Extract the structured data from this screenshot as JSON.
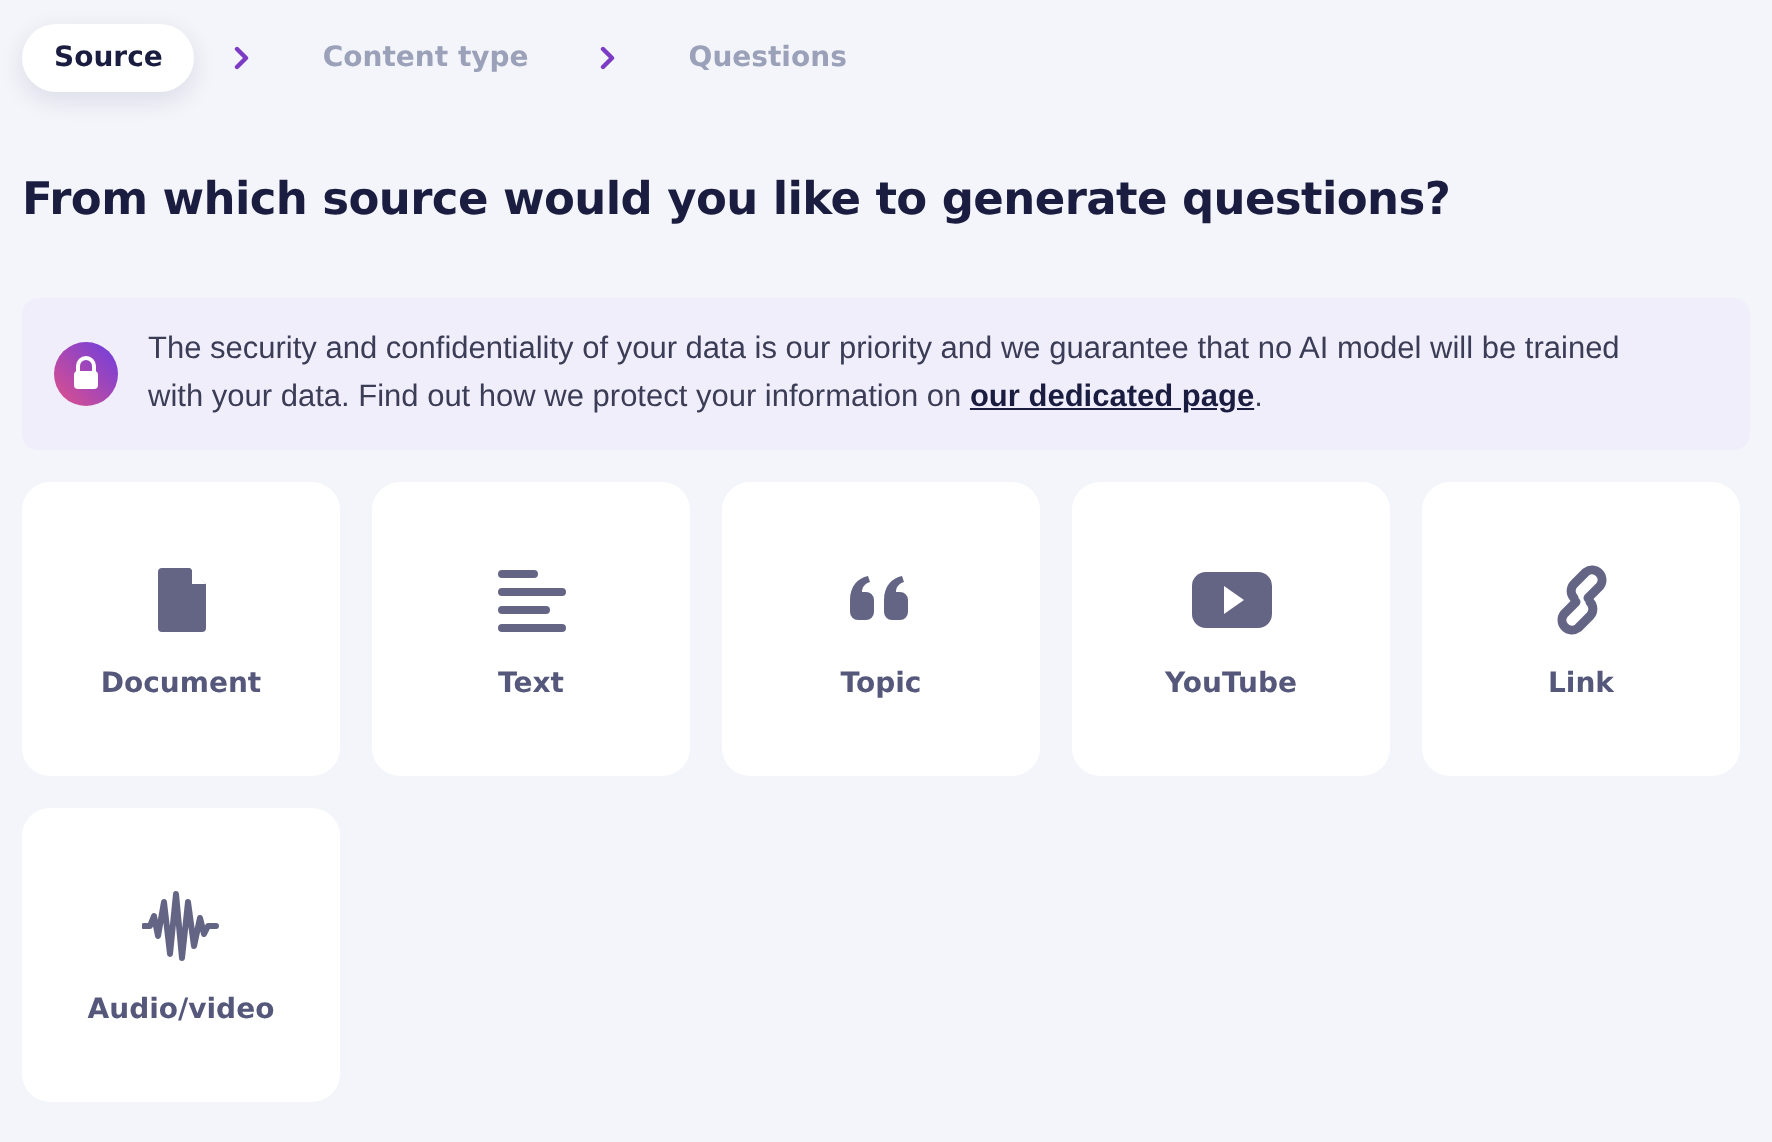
{
  "steps": [
    {
      "label": "Source",
      "selected": true
    },
    {
      "label": "Content type",
      "selected": false
    },
    {
      "label": "Questions",
      "selected": false
    }
  ],
  "heading": "From which source would you like to generate questions?",
  "notice": {
    "text": "The security and confidentiality of your data is our priority and we guarantee that no AI model will be trained with your data. Find out how we protect your information on",
    "link": "our dedicated page",
    "end": "."
  },
  "sources": [
    {
      "kind": "document",
      "label": "Document"
    },
    {
      "kind": "text",
      "label": "Text"
    },
    {
      "kind": "topic",
      "label": "Topic"
    },
    {
      "kind": "youtube",
      "label": "YouTube"
    },
    {
      "kind": "link",
      "label": "Link"
    },
    {
      "kind": "audio",
      "label": "Audio/video"
    }
  ]
}
